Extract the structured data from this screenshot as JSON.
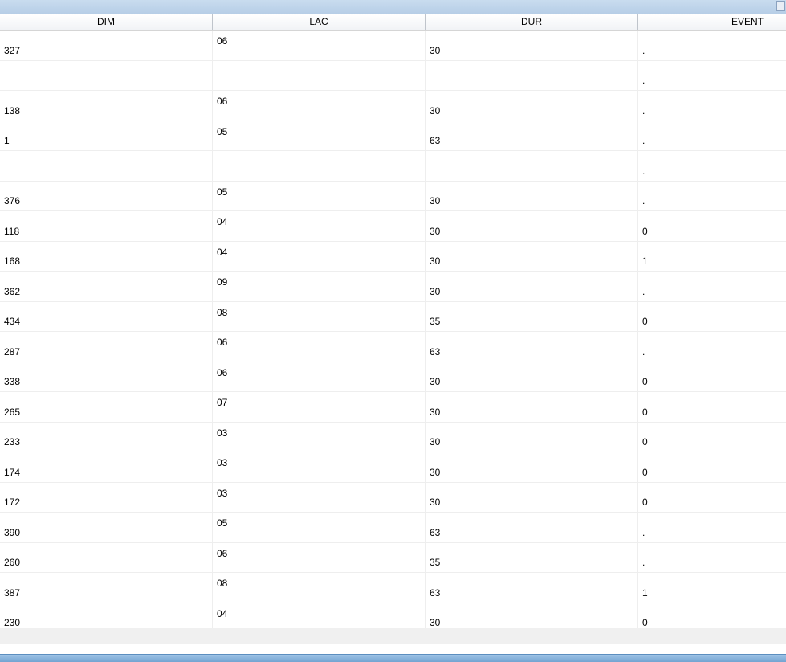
{
  "columns": [
    "DIM",
    "LAC",
    "DUR",
    "EVENT"
  ],
  "rows": [
    {
      "dim": "327",
      "lac": "06",
      "dur": "30",
      "event": "."
    },
    {
      "dim": "",
      "lac": "",
      "dur": "",
      "event": "."
    },
    {
      "dim": "138",
      "lac": "06",
      "dur": "30",
      "event": "."
    },
    {
      "dim": "1",
      "lac": "05",
      "dur": "63",
      "event": "."
    },
    {
      "dim": "",
      "lac": "",
      "dur": "",
      "event": "."
    },
    {
      "dim": "376",
      "lac": "05",
      "dur": "30",
      "event": "."
    },
    {
      "dim": "118",
      "lac": "04",
      "dur": "30",
      "event": "0"
    },
    {
      "dim": "168",
      "lac": "04",
      "dur": "30",
      "event": "1"
    },
    {
      "dim": "362",
      "lac": "09",
      "dur": "30",
      "event": "."
    },
    {
      "dim": "434",
      "lac": "08",
      "dur": "35",
      "event": "0"
    },
    {
      "dim": "287",
      "lac": "06",
      "dur": "63",
      "event": "."
    },
    {
      "dim": "338",
      "lac": "06",
      "dur": "30",
      "event": "0"
    },
    {
      "dim": "265",
      "lac": "07",
      "dur": "30",
      "event": "0"
    },
    {
      "dim": "233",
      "lac": "03",
      "dur": "30",
      "event": "0"
    },
    {
      "dim": "174",
      "lac": "03",
      "dur": "30",
      "event": "0"
    },
    {
      "dim": "172",
      "lac": "03",
      "dur": "30",
      "event": "0"
    },
    {
      "dim": "390",
      "lac": "05",
      "dur": "63",
      "event": "."
    },
    {
      "dim": "260",
      "lac": "06",
      "dur": "35",
      "event": "."
    },
    {
      "dim": "387",
      "lac": "08",
      "dur": "63",
      "event": "1"
    },
    {
      "dim": "230",
      "lac": "04",
      "dur": "30",
      "event": "0"
    }
  ]
}
